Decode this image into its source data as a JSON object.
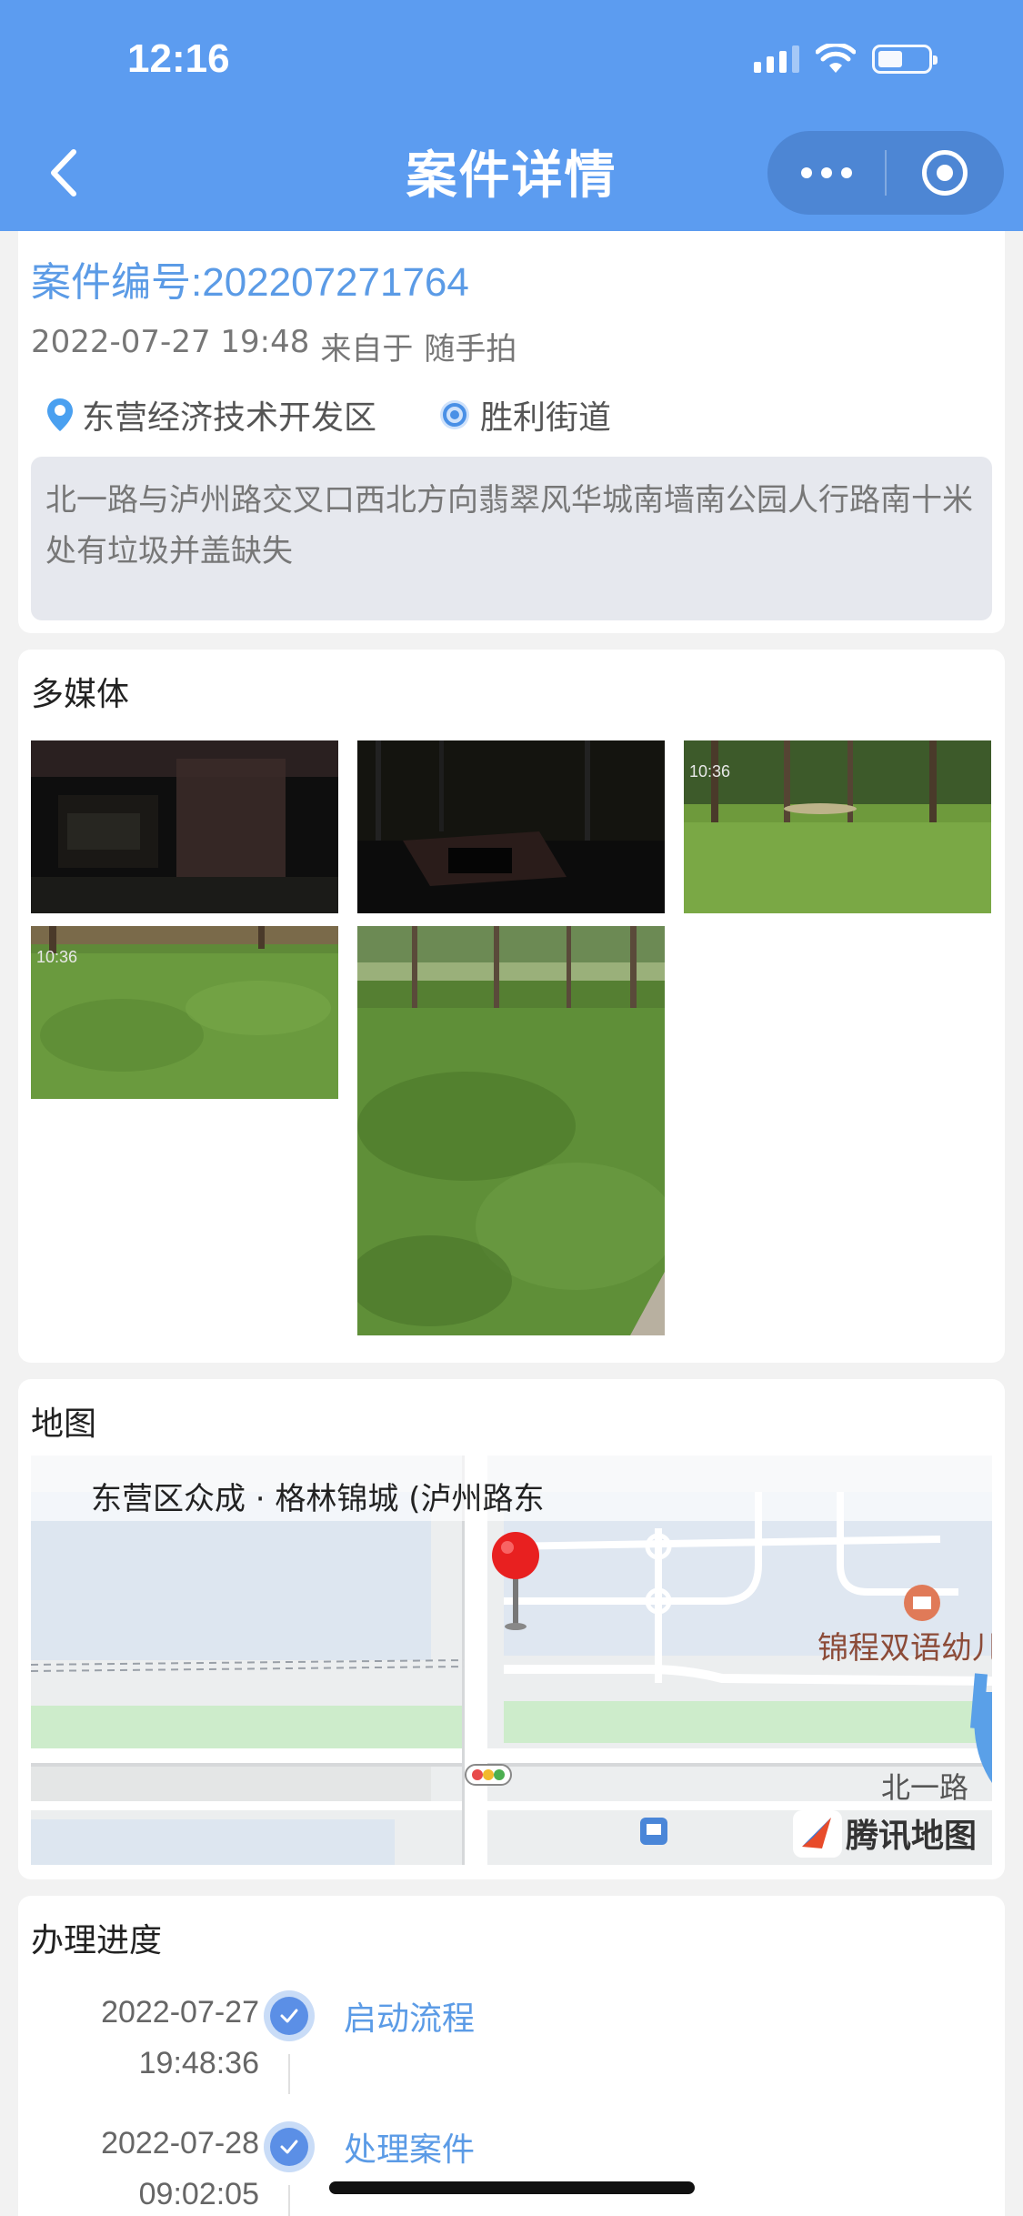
{
  "status_bar": {
    "time": "12:16"
  },
  "header": {
    "title": "案件详情"
  },
  "case": {
    "number": "案件编号:202207271764",
    "datetime": "2022-07-27 19:48",
    "source_prefix": "来自于",
    "source": "随手拍",
    "district": "东营经济技术开发区",
    "street": "胜利街道",
    "description": "北一路与泸州路交叉口西北方向翡翠风华城南墙南公园人行路南十米处有垃圾并盖缺失"
  },
  "media": {
    "title": "多媒体",
    "photos": [
      {
        "kind": "dark-manhole",
        "timestamp": ""
      },
      {
        "kind": "dark-manhole",
        "timestamp": ""
      },
      {
        "kind": "park-grass",
        "timestamp": "10:36"
      },
      {
        "kind": "grass-closeup",
        "timestamp": "10:36"
      },
      {
        "kind": "grass-tall",
        "timestamp": ""
      }
    ]
  },
  "map": {
    "title": "地图",
    "location": "东营区众成 · 格林锦城 (泸州路东",
    "poi_school": "锦程双语幼儿",
    "road_label": "北一路",
    "brand": "腾讯地图"
  },
  "progress": {
    "title": "办理进度",
    "steps": [
      {
        "date": "2022-07-27",
        "time": "19:48:36",
        "label": "启动流程"
      },
      {
        "date": "2022-07-28",
        "time": "09:02:05",
        "label": "处理案件"
      }
    ]
  },
  "colors": {
    "header": "#5c9cf0",
    "accent": "#5b9be6",
    "pin": "#e82020"
  },
  "icons": [
    "chevron-left-icon",
    "more-dots-icon",
    "target-icon",
    "location-pin-icon",
    "street-target-icon",
    "check-icon",
    "map-pin-icon",
    "traffic-light-icon",
    "bus-icon",
    "school-icon",
    "tencent-map-logo"
  ]
}
